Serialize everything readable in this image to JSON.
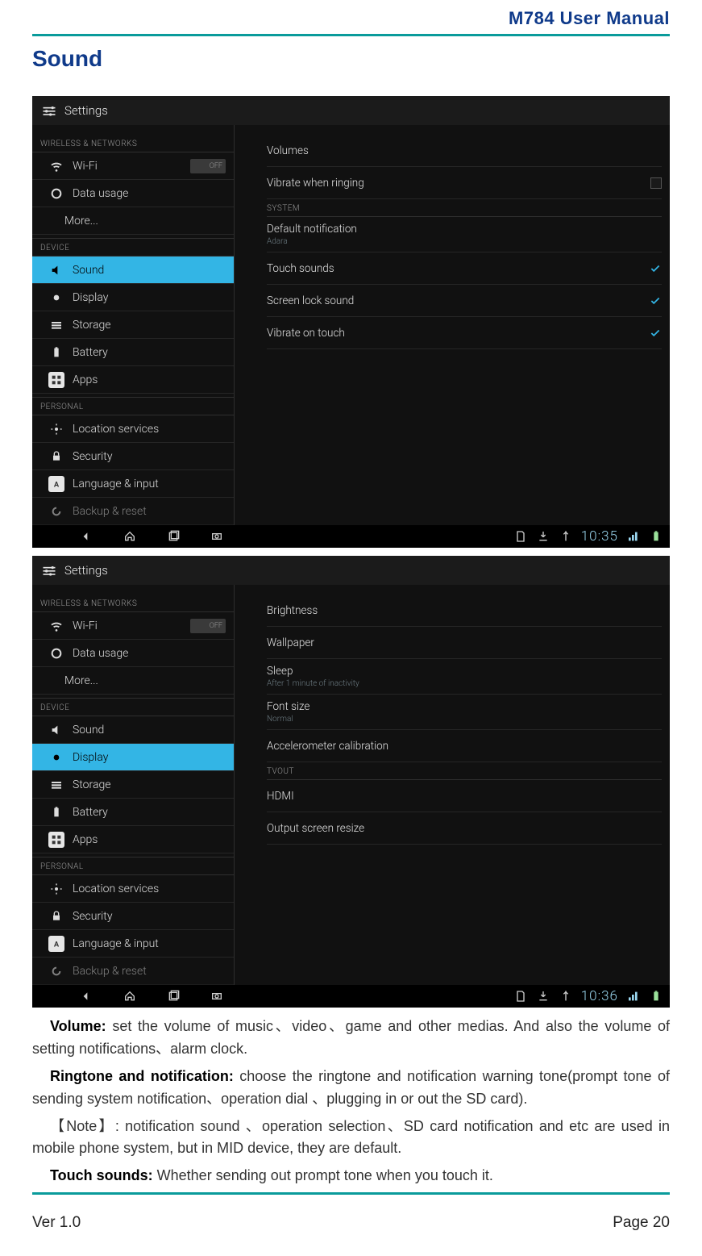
{
  "doc": {
    "header": "M784  User  Manual",
    "section_title": "Sound",
    "ver": "Ver 1.0",
    "page": "Page 20"
  },
  "screenshot1": {
    "app_title": "Settings",
    "sidebar": {
      "hdr_wireless": "WIRELESS & NETWORKS",
      "wifi": "Wi-Fi",
      "wifi_switch": "OFF",
      "data_usage": "Data usage",
      "more": "More...",
      "hdr_device": "DEVICE",
      "sound": "Sound",
      "display": "Display",
      "storage": "Storage",
      "battery": "Battery",
      "apps": "Apps",
      "hdr_personal": "PERSONAL",
      "location": "Location services",
      "security": "Security",
      "language": "Language & input",
      "backup": "Backup & reset"
    },
    "content": {
      "volumes": "Volumes",
      "vibrate_ring": "Vibrate when ringing",
      "hdr_system": "SYSTEM",
      "default_notif": "Default notification",
      "default_notif_sub": "Adara",
      "touch_sounds": "Touch sounds",
      "lock_sound": "Screen lock sound",
      "vibrate_touch": "Vibrate on touch"
    },
    "clock": "10:35"
  },
  "screenshot2": {
    "app_title": "Settings",
    "sidebar": {
      "hdr_wireless": "WIRELESS & NETWORKS",
      "wifi": "Wi-Fi",
      "wifi_switch": "OFF",
      "data_usage": "Data usage",
      "more": "More...",
      "hdr_device": "DEVICE",
      "sound": "Sound",
      "display": "Display",
      "storage": "Storage",
      "battery": "Battery",
      "apps": "Apps",
      "hdr_personal": "PERSONAL",
      "location": "Location services",
      "security": "Security",
      "language": "Language & input",
      "backup": "Backup & reset"
    },
    "content": {
      "brightness": "Brightness",
      "wallpaper": "Wallpaper",
      "sleep": "Sleep",
      "sleep_sub": "After 1 minute of inactivity",
      "font_size": "Font size",
      "font_size_sub": "Normal",
      "accel": "Accelerometer calibration",
      "hdr_tvout": "TVOUT",
      "hdmi": "HDMI",
      "resize": "Output screen resize"
    },
    "clock": "10:36"
  },
  "copy": {
    "p1b": "Volume:",
    "p1": " set the volume of music、video、game and other medias. And also the volume of setting notifications、alarm clock.",
    "p2b": "Ringtone and notification:",
    "p2": " choose the ringtone and notification warning tone(prompt tone of sending system notification、operation dial 、plugging in or out the SD card).",
    "p3": "【Note】: notification sound 、operation selection、SD card notification and etc are used in mobile phone system, but in MID device, they are default.",
    "p4b": "Touch sounds:",
    "p4": " Whether sending out prompt tone when you touch it."
  }
}
